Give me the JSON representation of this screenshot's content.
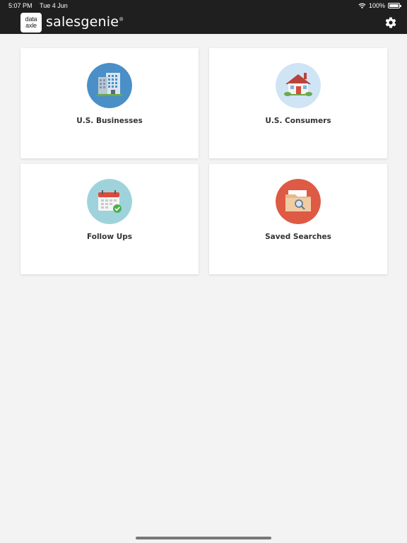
{
  "status_bar": {
    "time": "5:07 PM",
    "date": "Tue 4 Jun",
    "battery": "100%"
  },
  "header": {
    "logo_line1": "data",
    "logo_line2": "axle",
    "brand": "salesgenie",
    "trademark": "®"
  },
  "cards": [
    {
      "label": "U.S. Businesses",
      "icon": "office-building-icon",
      "circle_color": "#4a8fc7"
    },
    {
      "label": "U.S. Consumers",
      "icon": "house-icon",
      "circle_color": "#cfe4f5"
    },
    {
      "label": "Follow Ups",
      "icon": "calendar-check-icon",
      "circle_color": "#9fd3dc"
    },
    {
      "label": "Saved Searches",
      "icon": "folder-search-icon",
      "circle_color": "#de5a44"
    }
  ],
  "colors": {
    "topbar": "#1f1f1f",
    "background": "#f3f3f3",
    "card": "#ffffff"
  }
}
